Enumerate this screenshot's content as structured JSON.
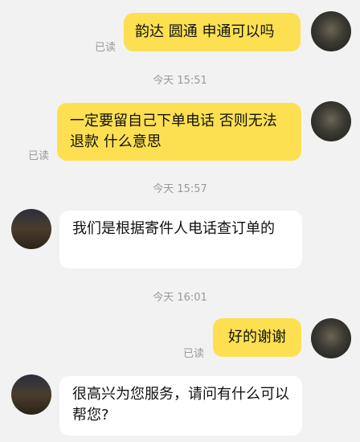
{
  "messages": [
    {
      "side": "out",
      "text": "韵达 圆通 申通可以吗",
      "status": "已读"
    },
    {
      "side": "out",
      "text": "一定要留自己下单电话 否则无法退款 什么意思",
      "status": "已读"
    },
    {
      "side": "in",
      "text": "我们是根据寄件人电话查订单的"
    },
    {
      "side": "out",
      "text": "好的谢谢",
      "status": "已读"
    },
    {
      "side": "in",
      "text": "很高兴为您服务，请问有什么可以帮您?"
    }
  ],
  "timestamps": [
    "今天 15:51",
    "今天 15:57",
    "今天 16:01"
  ],
  "colors": {
    "outgoing_bubble": "#fde052",
    "incoming_bubble": "#ffffff",
    "background": "#f2f2f2",
    "meta_text": "#9a9a9a"
  }
}
